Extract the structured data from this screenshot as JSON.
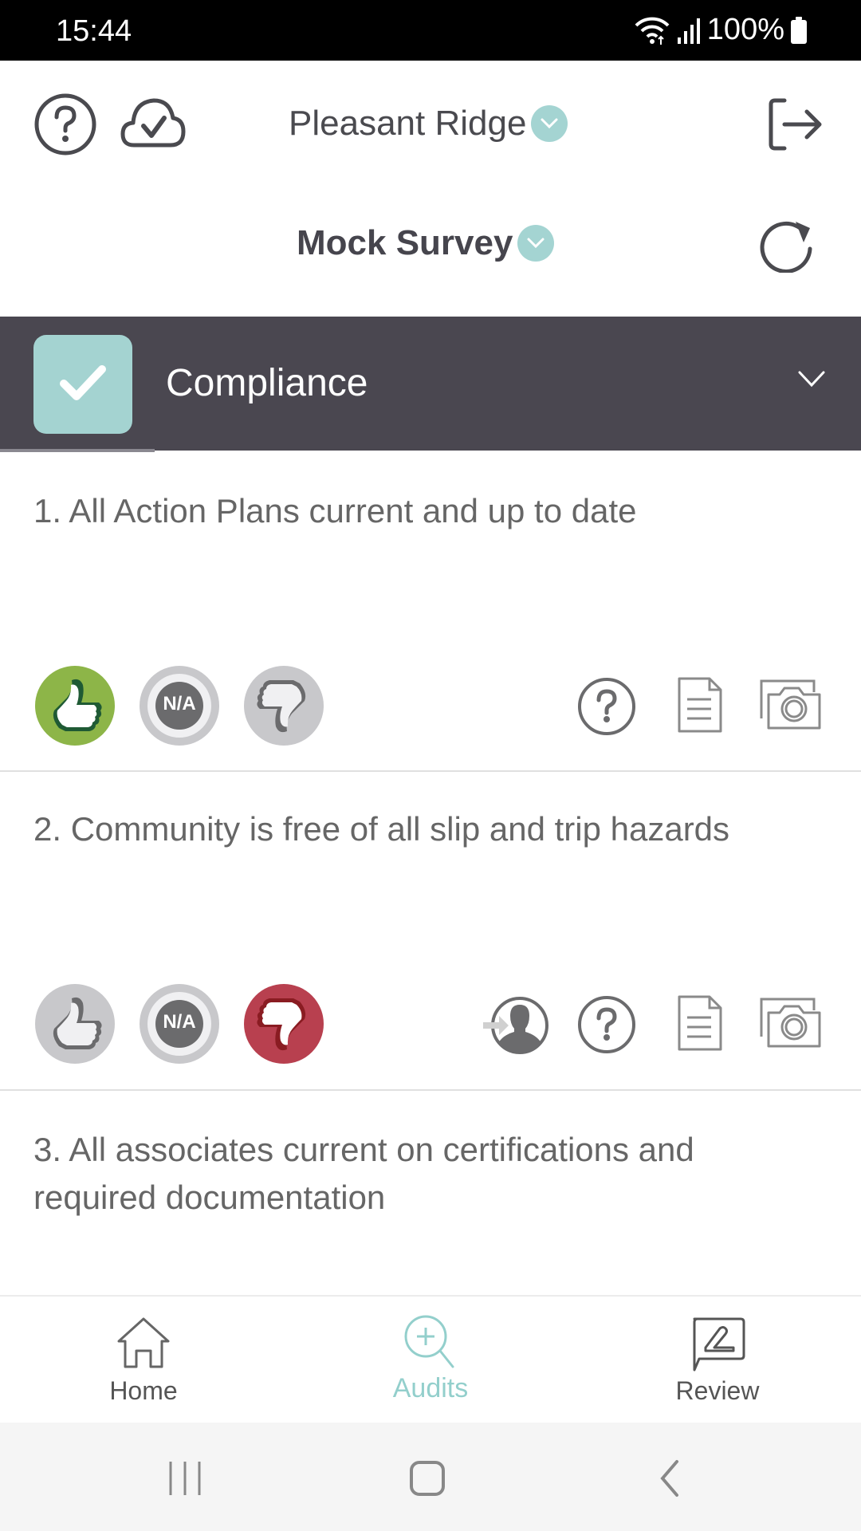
{
  "status_bar": {
    "time": "15:44",
    "battery": "100%",
    "icons": [
      "wifi-icon",
      "signal-icon",
      "battery-icon"
    ]
  },
  "header": {
    "help_icon": "help-circle-icon",
    "sync_icon": "cloud-check-icon",
    "site": "Pleasant Ridge",
    "survey": "Mock Survey",
    "logout_icon": "logout-icon",
    "refresh_icon": "refresh-icon"
  },
  "section": {
    "title": "Compliance",
    "checked": true,
    "expanded": true
  },
  "questions": [
    {
      "number": "1.",
      "text": "1. All Action Plans current and up to date",
      "answer": "yes",
      "na_label": "N/A",
      "actions": [
        "help",
        "notes",
        "photo"
      ]
    },
    {
      "number": "2.",
      "text": "2. Community is free of all slip and trip hazards",
      "answer": "no",
      "na_label": "N/A",
      "actions": [
        "assign",
        "help",
        "notes",
        "photo"
      ]
    },
    {
      "number": "3.",
      "text": "3. All associates current on certifications and required documentation",
      "answer": null
    }
  ],
  "bottom_nav": {
    "items": [
      {
        "label": "Home",
        "icon": "home-icon",
        "active": false
      },
      {
        "label": "Audits",
        "icon": "audit-search-icon",
        "active": true
      },
      {
        "label": "Review",
        "icon": "review-icon",
        "active": false
      }
    ]
  },
  "colors": {
    "accent": "#93cfcc",
    "section_bar": "#4a4750",
    "yes_active": "#8db548",
    "no_active": "#b8404f",
    "inactive": "#c8c8cb"
  }
}
